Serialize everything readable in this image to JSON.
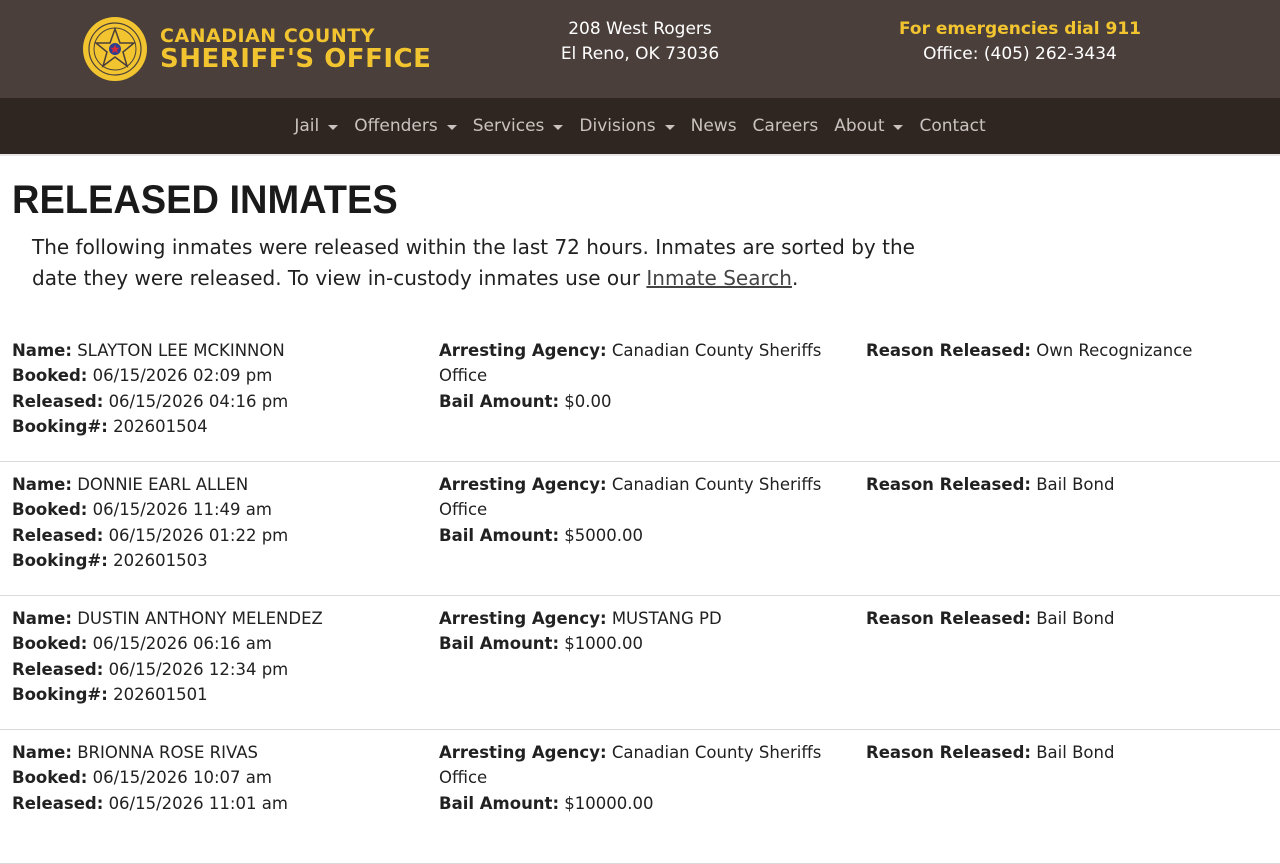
{
  "header": {
    "brand_line1": "CANADIAN COUNTY",
    "brand_line2": "SHERIFF'S OFFICE",
    "logo_icon": "sheriff-star-badge-icon",
    "address_line1": "208 West Rogers",
    "address_line2": "El Reno, OK 73036",
    "emergency": "For emergencies dial 911",
    "office_phone": "Office: (405) 262-3434",
    "colors": {
      "header_bg": "#4a3f3b",
      "nav_bg": "#2f2622",
      "accent": "#f2c42f"
    }
  },
  "nav": {
    "items": [
      {
        "label": "Jail",
        "dropdown": true
      },
      {
        "label": "Offenders",
        "dropdown": true
      },
      {
        "label": "Services",
        "dropdown": true
      },
      {
        "label": "Divisions",
        "dropdown": true
      },
      {
        "label": "News",
        "dropdown": false
      },
      {
        "label": "Careers",
        "dropdown": false
      },
      {
        "label": "About",
        "dropdown": true
      },
      {
        "label": "Contact",
        "dropdown": false
      }
    ]
  },
  "main": {
    "title": "RELEASED INMATES",
    "intro_text": "The following inmates were released within the last 72 hours. Inmates are sorted by the date they were released. To view in-custody inmates use our ",
    "intro_link": "Inmate Search",
    "intro_end": "."
  },
  "labels": {
    "name": "Name:",
    "booked": "Booked:",
    "released": "Released:",
    "booking": "Booking#:",
    "agency": "Arresting Agency:",
    "bail": "Bail Amount:",
    "reason": "Reason Released:"
  },
  "records": [
    {
      "name": "SLAYTON LEE MCKINNON",
      "booked": "06/15/2026 02:09 pm",
      "released": "06/15/2026 04:16 pm",
      "booking": "202601504",
      "agency": "Canadian County Sheriffs Office",
      "bail": "$0.00",
      "reason": "Own Recognizance"
    },
    {
      "name": "DONNIE EARL ALLEN",
      "booked": "06/15/2026 11:49 am",
      "released": "06/15/2026 01:22 pm",
      "booking": "202601503",
      "agency": "Canadian County Sheriffs Office",
      "bail": "$5000.00",
      "reason": "Bail Bond"
    },
    {
      "name": "DUSTIN ANTHONY MELENDEZ",
      "booked": "06/15/2026 06:16 am",
      "released": "06/15/2026 12:34 pm",
      "booking": "202601501",
      "agency": "MUSTANG PD",
      "bail": "$1000.00",
      "reason": "Bail Bond"
    },
    {
      "name": "BRIONNA ROSE RIVAS",
      "booked": "06/15/2026 10:07 am",
      "released": "06/15/2026 11:01 am",
      "booking": "",
      "agency": "Canadian County Sheriffs Office",
      "bail": "$10000.00",
      "reason": "Bail Bond"
    }
  ]
}
